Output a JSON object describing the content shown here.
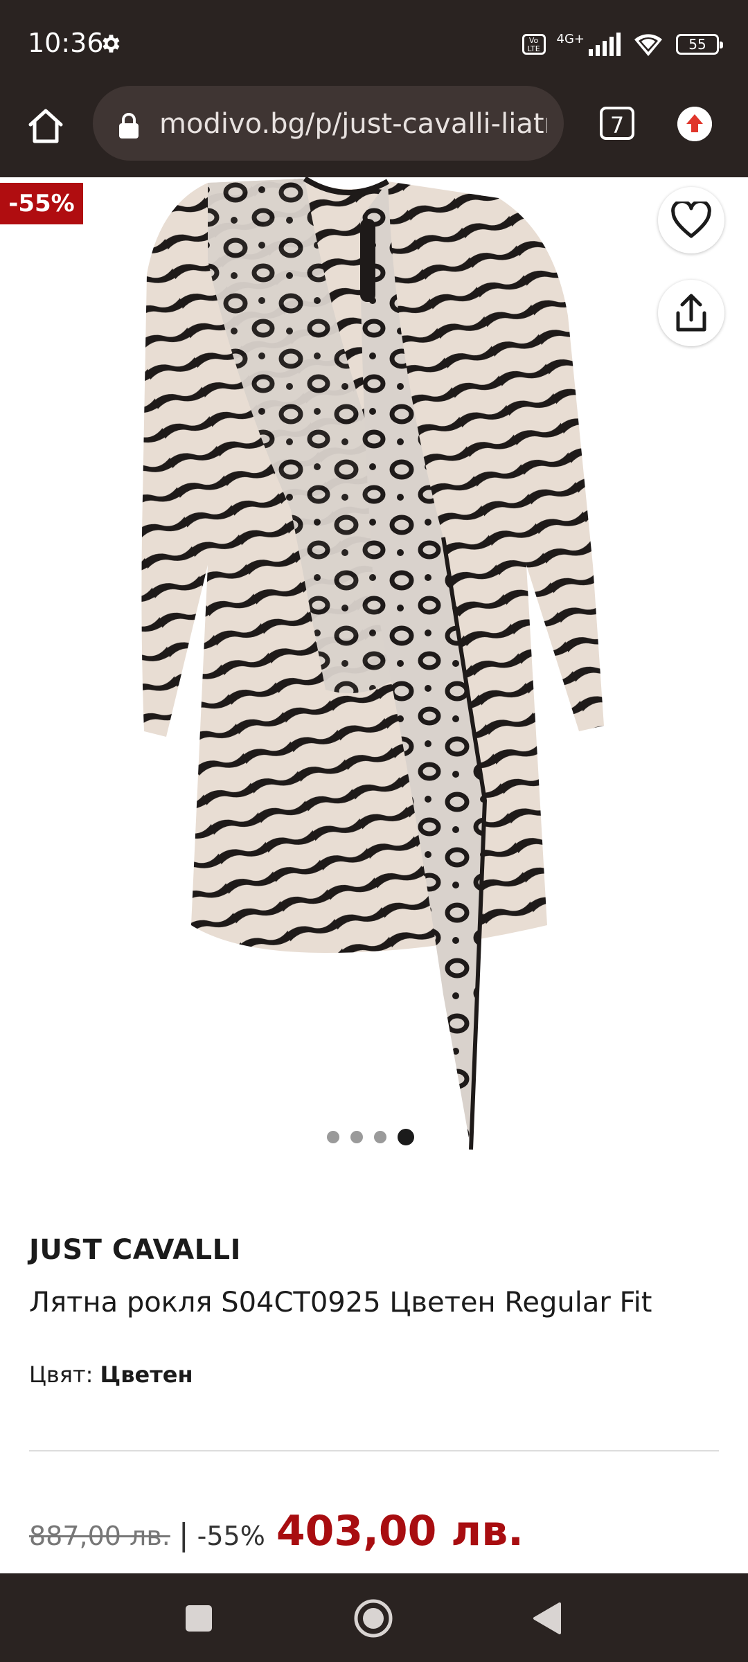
{
  "status_bar": {
    "time": "10:36",
    "volte_label": "Vo LTE",
    "network_label": "4G+",
    "battery": "55",
    "icons": [
      "settings-gear-icon",
      "volte-icon",
      "signal-icon",
      "wifi-icon",
      "battery-icon"
    ]
  },
  "browser": {
    "url": "modivo.bg/p/just-cavalli-liatr",
    "tab_count": "7",
    "icons": [
      "home-icon",
      "lock-icon",
      "tabs-icon",
      "update-icon"
    ]
  },
  "product_gallery": {
    "discount_badge": "-55%",
    "image_count": 4,
    "active_image_index": 4,
    "icons": [
      "heart-icon",
      "share-icon"
    ]
  },
  "product": {
    "brand": "JUST CAVALLI",
    "name": "Лятна рокля S04CT0925 Цветен Regular Fit",
    "color_label": "Цвят:",
    "color_value": "Цветен",
    "old_price": "887,00 лв.",
    "separator": "|",
    "discount": "-55%",
    "new_price": "403,00 лв."
  },
  "colors": {
    "bar_background": "#2a2321",
    "discount_red": "#b00d10",
    "price_red": "#a80d10"
  },
  "nav_bar": {
    "icons": [
      "recents-square-icon",
      "home-circle-icon",
      "back-triangle-icon"
    ]
  }
}
